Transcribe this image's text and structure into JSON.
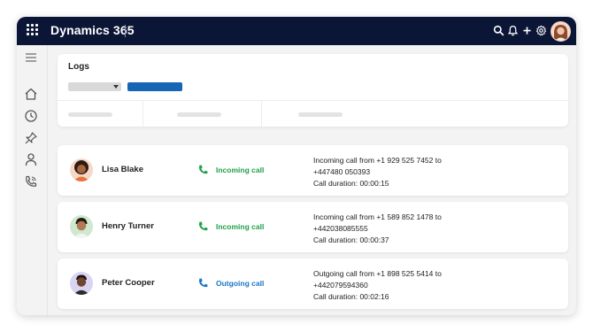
{
  "app": {
    "title": "Dynamics 365"
  },
  "header_icons": [
    "search-icon",
    "bell-icon",
    "plus-icon",
    "gear-icon",
    "user-avatar"
  ],
  "sidebar": {
    "items": [
      {
        "icon": "menu-icon"
      },
      {
        "icon": "home-icon"
      },
      {
        "icon": "clock-icon"
      },
      {
        "icon": "pin-icon"
      },
      {
        "icon": "person-icon"
      },
      {
        "icon": "phone-call-icon"
      }
    ]
  },
  "logs": {
    "title": "Logs"
  },
  "calls": [
    {
      "name": "Lisa Blake",
      "direction": "Incoming call",
      "direction_color": "#1fa048",
      "detail_line1": "Incoming call from +1 929 525 7452 to",
      "detail_line2": "+447480 050393",
      "detail_line3": "Call duration: 00:00:15"
    },
    {
      "name": "Henry Turner",
      "direction": "Incoming call",
      "direction_color": "#1fa048",
      "detail_line1": "Incoming call from +1 589 852 1478 to",
      "detail_line2": "+442038085555",
      "detail_line3": "Call duration: 00:00:37"
    },
    {
      "name": "Peter Cooper",
      "direction": "Outgoing call",
      "direction_color": "#1a74c9",
      "detail_line1": "Outgoing call from +1 898 525 5414 to",
      "detail_line2": "+442079594360",
      "detail_line3": "Call duration: 00:02:16"
    }
  ],
  "colors": {
    "topbar": "#0b1536",
    "primary_button": "#1765b5",
    "incoming": "#1fa048",
    "outgoing": "#1a74c9"
  }
}
